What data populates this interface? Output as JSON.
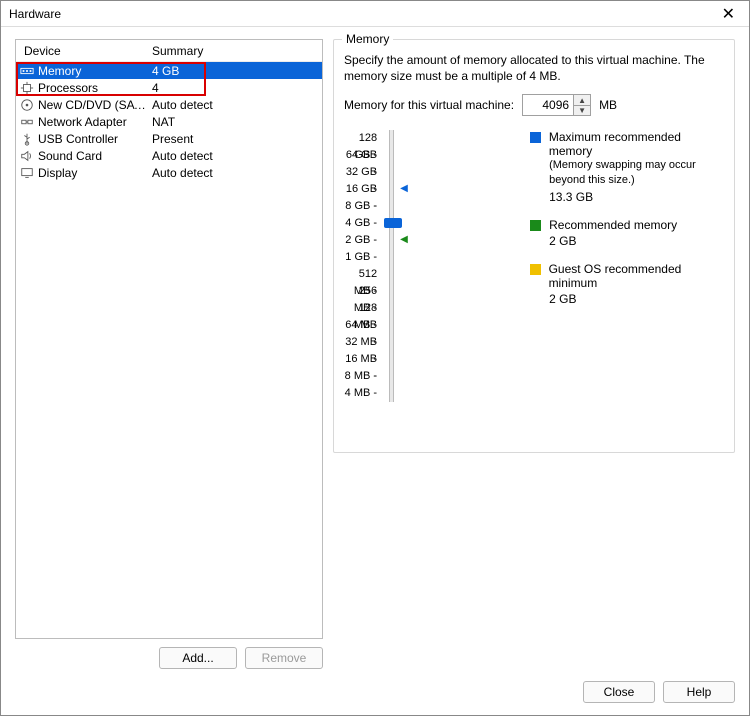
{
  "window": {
    "title": "Hardware"
  },
  "device_list": {
    "headers": {
      "device": "Device",
      "summary": "Summary"
    },
    "rows": [
      {
        "name": "Memory",
        "summary": "4 GB",
        "selected": true,
        "icon": "memory-icon"
      },
      {
        "name": "Processors",
        "summary": "4",
        "selected": false,
        "icon": "cpu-icon"
      },
      {
        "name": "New CD/DVD (SATA)",
        "summary": "Auto detect",
        "selected": false,
        "icon": "disc-icon"
      },
      {
        "name": "Network Adapter",
        "summary": "NAT",
        "selected": false,
        "icon": "network-icon"
      },
      {
        "name": "USB Controller",
        "summary": "Present",
        "selected": false,
        "icon": "usb-icon"
      },
      {
        "name": "Sound Card",
        "summary": "Auto detect",
        "selected": false,
        "icon": "sound-icon"
      },
      {
        "name": "Display",
        "summary": "Auto detect",
        "selected": false,
        "icon": "display-icon"
      }
    ]
  },
  "buttons": {
    "add": "Add...",
    "remove": "Remove",
    "close": "Close",
    "help": "Help"
  },
  "memory_group": {
    "label": "Memory",
    "description": "Specify the amount of memory allocated to this virtual machine. The memory size must be a multiple of 4 MB.",
    "input_label": "Memory for this virtual machine:",
    "value": "4096",
    "unit": "MB",
    "ticks": [
      "128 GB",
      "64 GB",
      "32 GB",
      "16 GB",
      "8 GB",
      "4 GB",
      "2 GB",
      "1 GB",
      "512 MB",
      "256 MB",
      "128 MB",
      "64 MB",
      "32 MB",
      "16 MB",
      "8 MB",
      "4 MB"
    ],
    "current_tick_index": 5,
    "markers": {
      "max_index": 3,
      "rec_index": 6
    },
    "legend": {
      "max": {
        "label": "Maximum recommended memory",
        "sub": "(Memory swapping may occur beyond this size.)",
        "value": "13.3 GB",
        "color": "#0a64d8"
      },
      "rec": {
        "label": "Recommended memory",
        "value": "2 GB",
        "color": "#1a8a1a"
      },
      "min": {
        "label": "Guest OS recommended minimum",
        "value": "2 GB",
        "color": "#f0c000"
      }
    }
  }
}
